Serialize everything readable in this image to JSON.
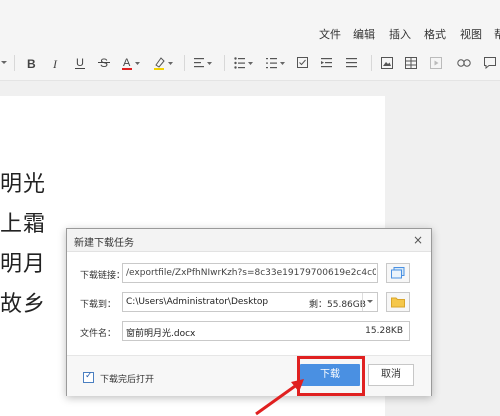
{
  "menu": {
    "items": [
      "文件",
      "编辑",
      "插入",
      "格式",
      "视图",
      "帮"
    ]
  },
  "toolbar": {
    "icons": [
      "chevron-down-icon",
      "bold-icon",
      "italic-icon",
      "underline-icon",
      "strikethrough-icon",
      "font-color-icon",
      "highlight-icon",
      "align-icon",
      "bullet-list-icon",
      "numbered-list-icon",
      "checklist-icon",
      "indent-decrease-icon",
      "indent-increase-icon",
      "image-icon",
      "table-icon",
      "media-icon",
      "link-icon",
      "comment-icon"
    ]
  },
  "document": {
    "lines": [
      "明光",
      "上霜",
      "明月",
      "故乡"
    ]
  },
  "dialog": {
    "title": "新建下载任务",
    "close": "×",
    "link_label": "下载链接：",
    "link_value": "/exportfile/ZxPfhNIwrKzh?s=8c33e19179700619e2c4c01408e6772b",
    "path_label": "下载到：",
    "path_value": "C:\\Users\\Administrator\\Desktop",
    "space_label": "剩：55.86GB",
    "filename_label": "文件名：",
    "filename_value": "窗前明月光.docx",
    "file_size": "15.28KB",
    "open_after_label": "下载完后打开",
    "open_after_checked": "✓",
    "download_button": "下载",
    "cancel_button": "取消"
  },
  "colors": {
    "accent": "#4a90e2",
    "highlight": "#e02020"
  }
}
